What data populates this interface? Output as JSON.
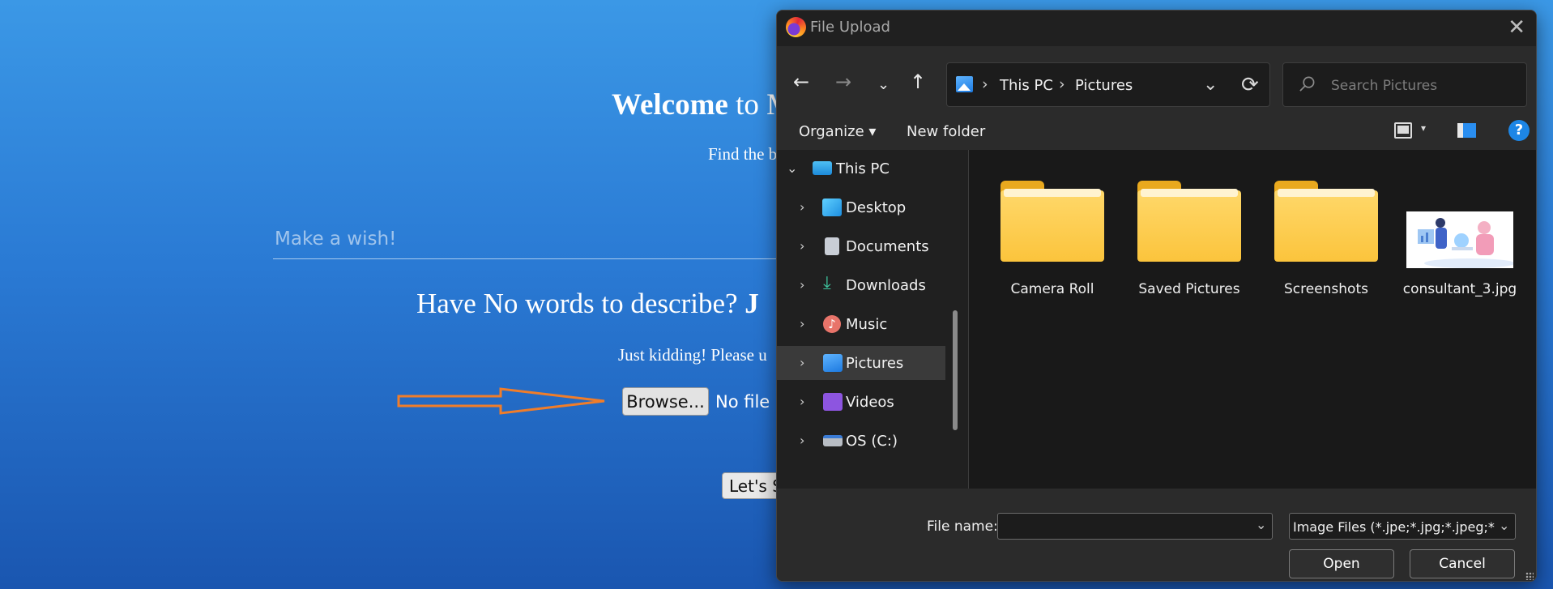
{
  "page": {
    "welcome_bold": "Welcome",
    "welcome_rest": " to M",
    "find_text": "Find the b",
    "wish_placeholder": "Make a wish!",
    "no_words": "Have No words to describe? ",
    "no_words_bold": "J",
    "kidding": "Just kidding! Please u",
    "browse_label": "Browse...",
    "no_file": "No file s",
    "lets_label": "Let's S"
  },
  "dialog": {
    "title": "File Upload",
    "breadcrumb": [
      "This PC",
      "Pictures"
    ],
    "search_placeholder": "Search Pictures",
    "toolbar": {
      "organize": "Organize ▾",
      "new_folder": "New folder"
    },
    "sidebar": [
      {
        "label": "This PC",
        "icon": "monitor-icon",
        "expanded": true
      },
      {
        "label": "Desktop",
        "icon": "desktop-icon"
      },
      {
        "label": "Documents",
        "icon": "documents-icon"
      },
      {
        "label": "Downloads",
        "icon": "download-icon"
      },
      {
        "label": "Music",
        "icon": "music-icon"
      },
      {
        "label": "Pictures",
        "icon": "pictures-icon",
        "selected": true
      },
      {
        "label": "Videos",
        "icon": "videos-icon"
      },
      {
        "label": "OS (C:)",
        "icon": "drive-icon"
      }
    ],
    "files": [
      {
        "label": "Camera Roll",
        "type": "folder"
      },
      {
        "label": "Saved Pictures",
        "type": "folder"
      },
      {
        "label": "Screenshots",
        "type": "folder"
      },
      {
        "label": "consultant_3.jpg",
        "type": "image"
      }
    ],
    "file_name_label": "File name:",
    "file_name_value": "",
    "filter": "Image Files (*.jpe;*.jpg;*.jpeg;*.gif;*.png)",
    "open_label": "Open",
    "cancel_label": "Cancel"
  },
  "colors": {
    "accent": "#1d86e6",
    "folder": "#fbc43c",
    "arrow": "#f07d2a"
  }
}
